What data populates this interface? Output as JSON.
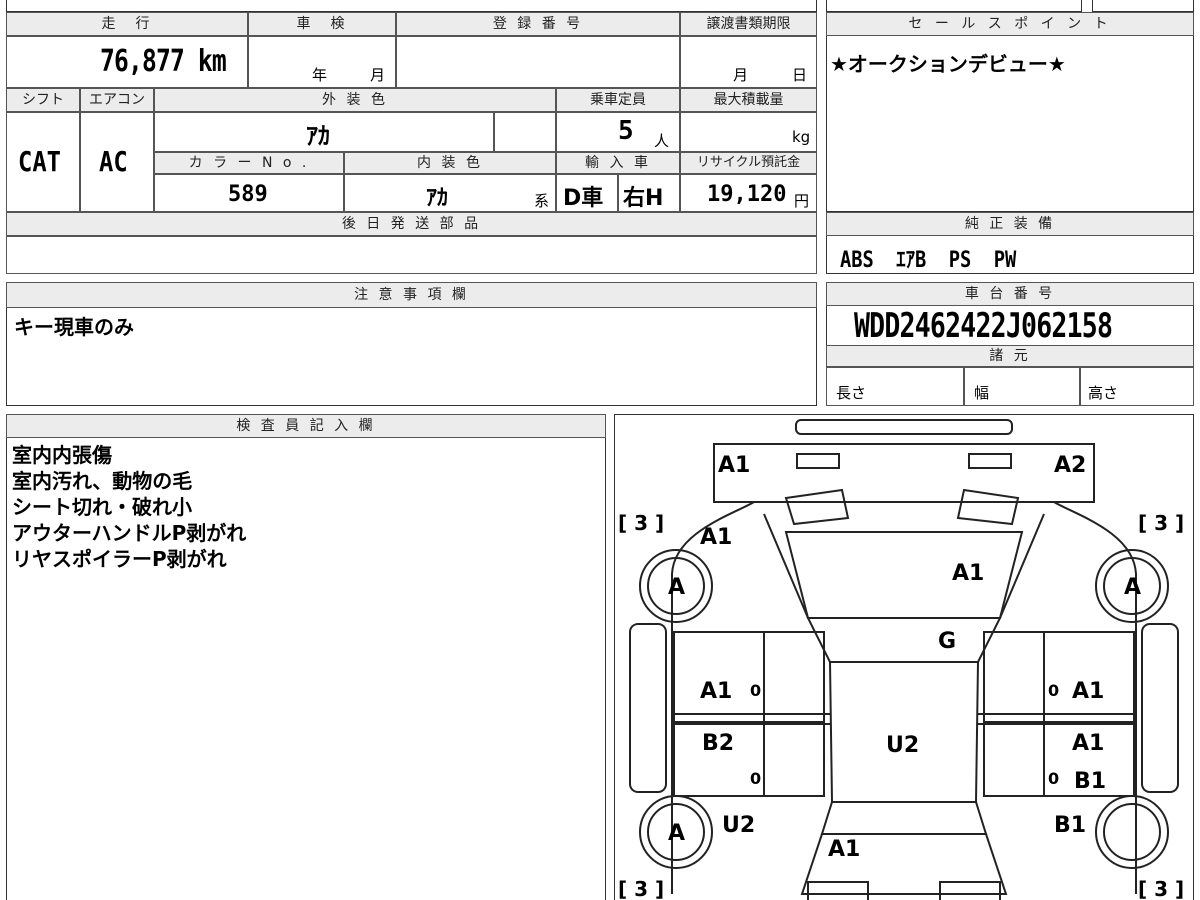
{
  "spec": {
    "headers": {
      "mileage": "走　行",
      "inspection": "車　検",
      "registration": "登 録 番 号",
      "transfer_deadline": "譲渡書類期限",
      "shift": "シフト",
      "aircon": "エアコン",
      "exterior_color": "外 装 色",
      "capacity": "乗車定員",
      "max_load": "最大積載量",
      "color_no": "カ ラ ー  N o .",
      "interior_color": "内 装 色",
      "import": "輸 入 車",
      "recycle": "リサイクル預託金"
    },
    "mileage": "76,877 km",
    "inspection_year": "年",
    "inspection_month": "月",
    "transfer_month": "月",
    "transfer_day": "日",
    "shift": "CAT",
    "aircon": "AC",
    "exterior_color": "ｱｶ",
    "capacity": "5",
    "capacity_unit": "人",
    "max_load_unit": "kg",
    "color_no": "589",
    "interior_color": "ｱｶ",
    "interior_suffix": "系",
    "import_type": "D車",
    "steering": "右H",
    "recycle_fee": "19,120",
    "recycle_unit": "円"
  },
  "sales_point": {
    "header": "セ ー ル ス ポ イ ン ト",
    "text": "★オークションデビュー★"
  },
  "later_parts": {
    "header": "後 日 発 送 部 品",
    "text": ""
  },
  "genuine_equipment": {
    "header": "純 正 装 備",
    "text": "ABS  ｴｱB  PS  PW"
  },
  "caution": {
    "header": "注 意 事 項 欄",
    "text": "キー現車のみ"
  },
  "chassis": {
    "header": "車 台 番 号",
    "number": "WDD2462422J062158",
    "specs_header": "諸 元",
    "length": "長さ",
    "width": "幅",
    "height": "高さ"
  },
  "inspector": {
    "header": "検 査 員 記 入 欄",
    "notes": [
      "室内内張傷",
      "室内汚れ、動物の毛",
      "シート切れ・破れ小",
      "アウターハンドルP剥がれ",
      "リヤスポイラーP剥がれ"
    ]
  },
  "diagram": {
    "labels": {
      "front_left_bumper": "A1",
      "front_right_bumper": "A2",
      "hood": "A1",
      "left_front_fender": "A1",
      "windshield": "G",
      "left_front_door": "A1",
      "right_front_door": "A1",
      "left_rear_door": "B2",
      "right_rear_door_upper": "A1",
      "right_rear_door_lower": "B1",
      "roof": "U2",
      "left_rear_fender": "U2",
      "right_rear_fender": "B1",
      "trunk": "A1",
      "tire_fl": "A",
      "tire_fr": "A",
      "tire_rl": "A",
      "tire_rr": "A",
      "tread_fl": "[ 3 ]",
      "tread_fr": "[ 3 ]",
      "tread_rl": "[ 3 ]",
      "tread_rr": "[ 3 ]",
      "zero": "0"
    }
  }
}
